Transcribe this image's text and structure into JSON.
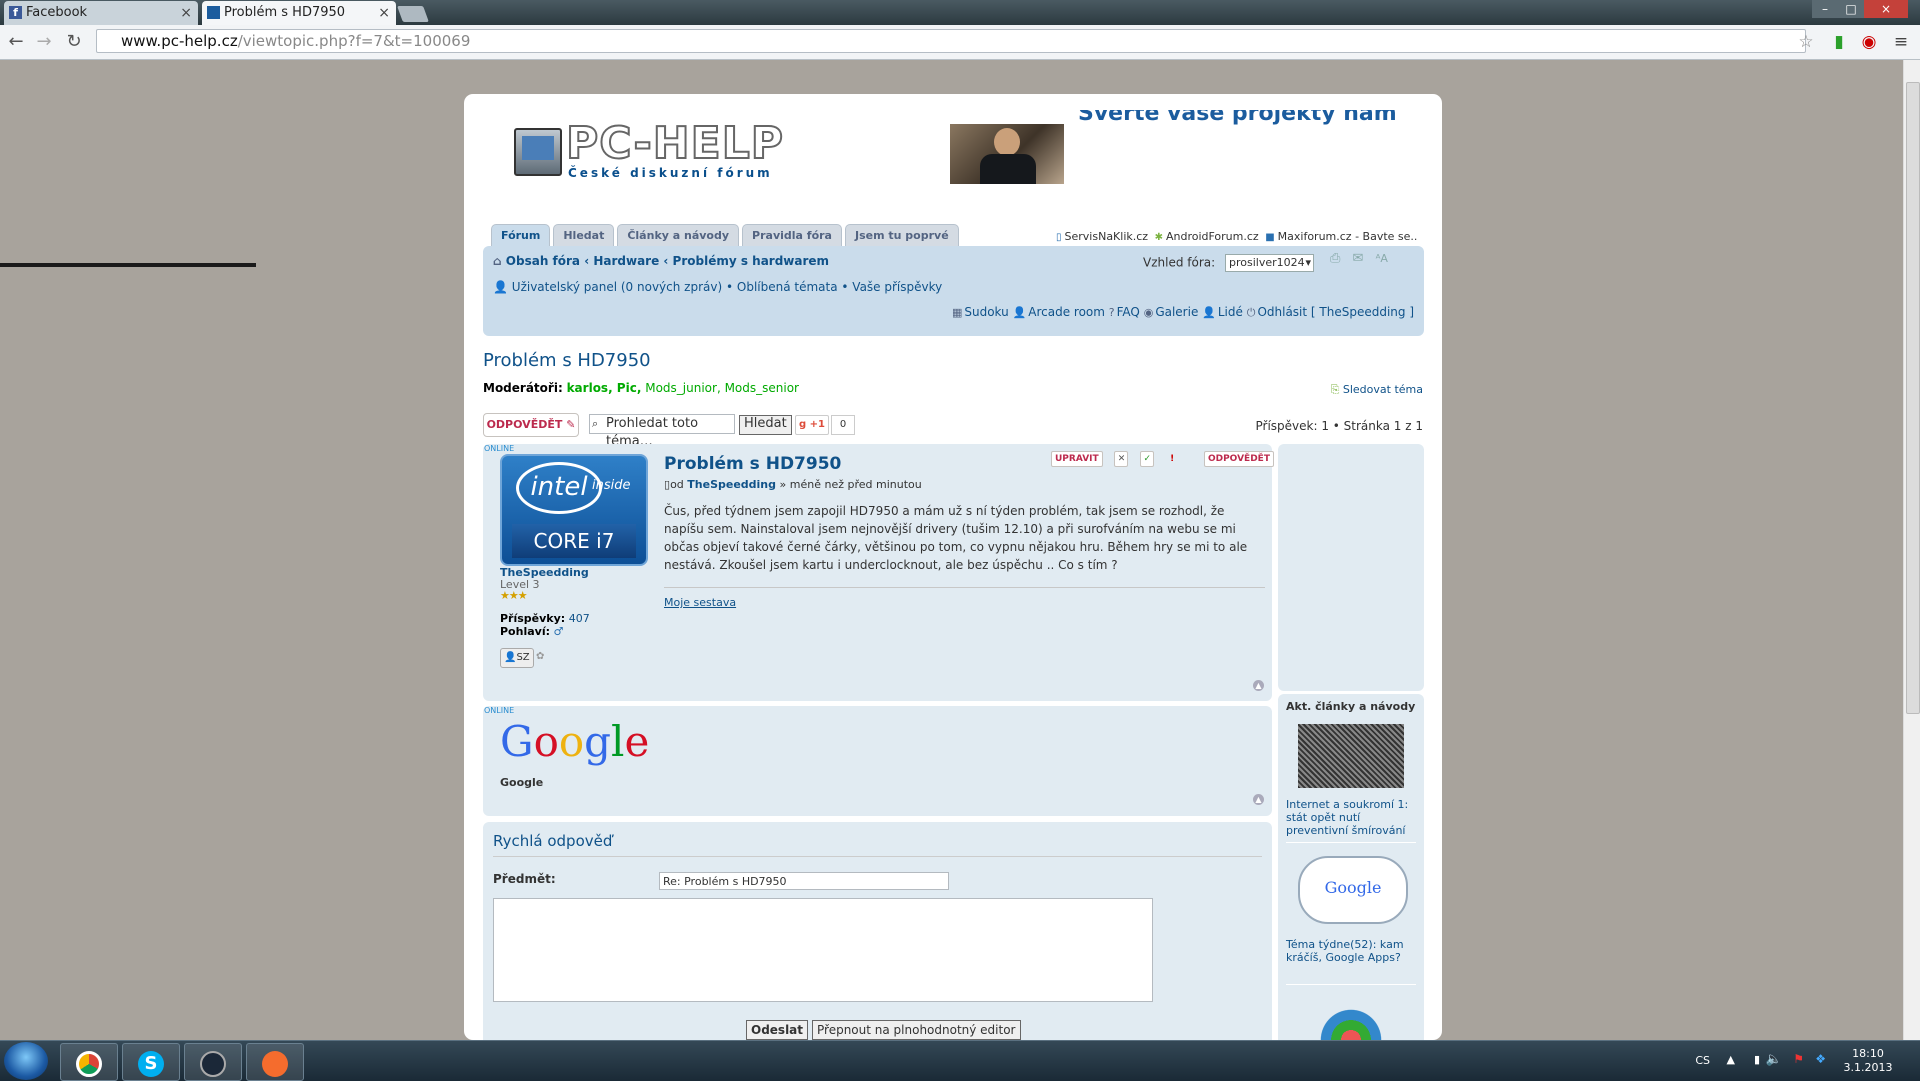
{
  "browser": {
    "tabs": [
      {
        "label": "Facebook",
        "active": false
      },
      {
        "label": "Problém s HD7950",
        "active": true
      }
    ],
    "url_host": "www.pc-help.cz",
    "url_path": "/viewtopic.php?f=7&t=100069"
  },
  "header": {
    "logo_text": "PC-HELP",
    "logo_subtitle": "České diskuzní fórum",
    "banner_text": "Svěřte vaše projekty nám"
  },
  "forum_tabs": [
    "Fórum",
    "Hledat",
    "Články a návody",
    "Pravidla fóra",
    "Jsem tu poprvé"
  ],
  "top_links": [
    "ServisNaKlik.cz",
    "AndroidForum.cz",
    "Maxiforum.cz - Bavte se.."
  ],
  "navbar": {
    "crumbs": [
      "Obsah fóra",
      "Hardware",
      "Problémy s hardwarem"
    ],
    "style_label": "Vzhled fóra:",
    "style_value": "prosilver1024",
    "userpanel": "Uživatelský panel (0 nových zpráv)",
    "favorites": "Oblíbená témata",
    "your_posts": "Vaše příspěvky",
    "util_links": [
      "Sudoku",
      "Arcade room",
      "FAQ",
      "Galerie",
      "Lidé",
      "Odhlásit [ TheSpeedding ]"
    ]
  },
  "topic": {
    "title": "Problém s HD7950",
    "moderators_label": "Moderátoři:",
    "moderators_main": "karlos, Pic,",
    "moderators_groups": "Mods_junior, Mods_senior",
    "follow": "Sledovat téma",
    "reply_label": "ODPOVĚDĚT",
    "search_placeholder": "Prohledat toto téma…",
    "search_button": "Hledat",
    "gplus_label": "+1",
    "gplus_count": "0",
    "pagination": "Příspěvek: 1 • Stránka 1 z 1"
  },
  "post": {
    "online": "ONLINE",
    "avatar_brand": "intel",
    "avatar_inside": "inside",
    "avatar_core": "CORE i7",
    "author": "TheSpeedding",
    "rank": "Level 3",
    "posts_label": "Příspěvky:",
    "posts_count": "407",
    "gender_label": "Pohlaví:",
    "title": "Problém s HD7950",
    "meta_by": "od",
    "meta_author": "TheSpeedding",
    "meta_time": "» méně než před minutou",
    "body": "Čus, před týdnem jsem zapojil HD7950 a mám už s ní týden problém, tak jsem se rozhodl, že napíšu sem. Nainstaloval jsem nejnovější drivery (tušim 12.10) a při surofváním na webu se mi občas objeví takové černé čárky, většinou po tom, co vypnu nějakou hru. Během hry se mi to ale nestává. Zkoušel jsem kartu i underclocknout, ale bez úspěchu .. Co s tím ?",
    "signature": "Moje sestava",
    "tool_edit": "UPRAVIT",
    "tool_reply": "ODPOVĚDĚT",
    "contact": "SZ"
  },
  "post2": {
    "online": "ONLINE",
    "avatar": "Google",
    "author": "Google"
  },
  "sidebar": {
    "head": "Akt. články a návody",
    "articles": [
      "Internet a soukromí 1: stát opět nutí preventivní šmírování",
      "Téma týdne(52): kam kráčíš, Google Apps?"
    ]
  },
  "quick_reply": {
    "title": "Rychlá odpověď",
    "subject_label": "Předmět:",
    "subject_value": "Re: Problém s HD7950",
    "send": "Odeslat",
    "full_editor": "Přepnout na plnohodnotný editor"
  },
  "taskbar": {
    "lang": "CS",
    "time": "18:10",
    "date": "3.1.2013"
  },
  "colors": {
    "link": "#105289",
    "post_bg": "#e1ebf2",
    "navbar_bg": "#cadceb",
    "reply_red": "#bc2a4d",
    "moderator_green": "#00aa00"
  }
}
